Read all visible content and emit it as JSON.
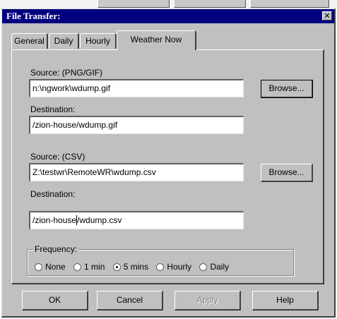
{
  "window": {
    "title": "File Transfer:",
    "close_glyph": "✕"
  },
  "tabs": [
    {
      "label": "General",
      "active": false
    },
    {
      "label": "Daily",
      "active": false
    },
    {
      "label": "Hourly",
      "active": false
    },
    {
      "label": "Weather Now",
      "active": true
    }
  ],
  "section1": {
    "source_label": "Source: (PNG/GIF)",
    "source_value": "n:\\ngwork\\wdump.gif",
    "browse_label": "Browse...",
    "destination_label": "Destination:",
    "destination_value": "/zion-house/wdump.gif"
  },
  "section2": {
    "source_label": "Source: (CSV)",
    "source_value": "Z:\\testwr\\RemoteWR\\wdump.csv",
    "browse_label": "Browse...",
    "destination_label": "Destination:",
    "destination_value_before_caret": "/zion-house",
    "destination_value_after_caret": "/wdump.csv"
  },
  "frequency": {
    "label": "Frequency:",
    "options": [
      "None",
      "1 min",
      "5 mins",
      "Hourly",
      "Daily"
    ],
    "selected": "5 mins"
  },
  "buttons": {
    "ok": "OK",
    "cancel": "Cancel",
    "apply": "Apply",
    "help": "Help"
  }
}
